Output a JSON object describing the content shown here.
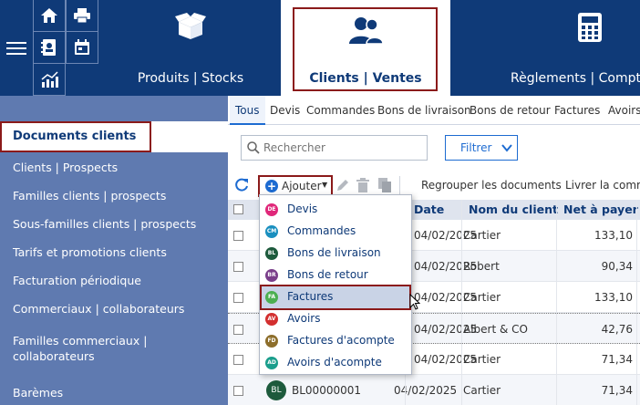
{
  "topbar": {
    "modules": [
      {
        "label": "Produits | Stocks",
        "icon": "box-open-icon"
      },
      {
        "label": "Clients | Ventes",
        "icon": "users-icon"
      },
      {
        "label": "Règlements | Compta",
        "icon": "calculator-icon"
      }
    ],
    "quick_icons": [
      "home-icon",
      "printer-icon",
      "contacts-book-icon",
      "calendar-icon",
      "stats-chart-icon"
    ]
  },
  "sidebar": {
    "active": "Documents clients",
    "items": [
      "Clients | Prospects",
      "Familles clients | prospects",
      "Sous-familles clients | prospects",
      "Tarifs et promotions clients",
      "Facturation périodique",
      "Commerciaux | collaborateurs",
      "Familles commerciaux | collaborateurs",
      "Barèmes"
    ]
  },
  "tabs": [
    "Tous",
    "Devis",
    "Commandes",
    "Bons de livraison",
    "Bons de retour",
    "Factures",
    "Avoirs"
  ],
  "search": {
    "placeholder": "Rechercher"
  },
  "filter": {
    "label": "Filtrer"
  },
  "toolbar": {
    "add_label": "Ajouter",
    "group_label": "Regrouper les documents",
    "deliver_label": "Livrer la comma"
  },
  "table": {
    "headers": {
      "date": "Date",
      "client": "Nom du client",
      "net": "Net à payer"
    },
    "rows": [
      {
        "date": "04/02/2025",
        "client": "Cartier",
        "net": "133,10"
      },
      {
        "date": "04/02/2025",
        "client": "Robert",
        "net": "90,34"
      },
      {
        "date": "04/02/2025",
        "client": "Cartier",
        "net": "133,10"
      },
      {
        "date": "04/02/2025",
        "client": "Albert & CO",
        "net": "42,76"
      },
      {
        "date": "04/02/2025",
        "client": "Cartier",
        "net": "71,34"
      },
      {
        "badge": "BL",
        "number": "BL00000001",
        "date": "04/02/2025",
        "client": "Cartier",
        "net": "71,34"
      }
    ]
  },
  "dropdown": {
    "items": [
      {
        "code": "DE",
        "label": "Devis",
        "color": "#e0287a"
      },
      {
        "code": "CM",
        "label": "Commandes",
        "color": "#1a8fbf"
      },
      {
        "code": "BL",
        "label": "Bons de livraison",
        "color": "#1d5a3c"
      },
      {
        "code": "BR",
        "label": "Bons de retour",
        "color": "#7a3e8a"
      },
      {
        "code": "FA",
        "label": "Factures",
        "color": "#4caf50"
      },
      {
        "code": "AV",
        "label": "Avoirs",
        "color": "#d32f2f"
      },
      {
        "code": "FD",
        "label": "Factures d'acompte",
        "color": "#8d6e2b"
      },
      {
        "code": "AD",
        "label": "Avoirs d'acompte",
        "color": "#1a9e8c"
      }
    ],
    "selected": "Factures"
  },
  "colors": {
    "brand": "#0f3a78",
    "sidebar": "#5f7ab0",
    "accent": "#1d6bd1",
    "highlight": "#8b1a1a"
  }
}
